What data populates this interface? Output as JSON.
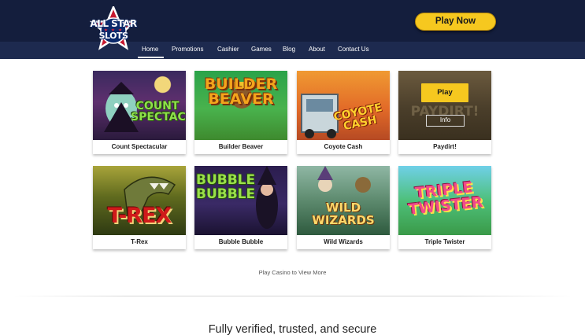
{
  "header": {
    "logo": {
      "line1": "ALL STAR",
      "line2": "SLOTS",
      "stars": "★ ★ ★"
    },
    "cta_label": "Play Now"
  },
  "nav": {
    "items": [
      {
        "label": "Home",
        "active": true
      },
      {
        "label": "Promotions"
      },
      {
        "label": "Cashier"
      },
      {
        "label": "Games"
      },
      {
        "label": "Blog"
      },
      {
        "label": "About"
      },
      {
        "label": "Contact Us"
      }
    ]
  },
  "games": [
    {
      "name": "Count Spectacular",
      "art": "COUNT SPECTACULAR"
    },
    {
      "name": "Builder Beaver",
      "art": "BUILDER BEAVER"
    },
    {
      "name": "Coyote Cash",
      "art": "COYOTE CASH"
    },
    {
      "name": "Paydirt!",
      "art": "PAYDIRT!"
    },
    {
      "name": "T-Rex",
      "art": "T-REX"
    },
    {
      "name": "Bubble Bubble",
      "art": "BUBBLE BUBBLE"
    },
    {
      "name": "Wild Wizards",
      "art": "WILD WIZARDS"
    },
    {
      "name": "Triple Twister",
      "art": "TRIPLE TWISTER"
    }
  ],
  "hover_card": {
    "play_label": "Play",
    "info_label": "Info"
  },
  "view_more": "Play Casino to View More",
  "secure_heading": "Fully verified, trusted, and secure",
  "colors": {
    "header_bg": "#141e3d",
    "nav_bg": "#1d2a4f",
    "accent_yellow": "#f6c81f"
  }
}
